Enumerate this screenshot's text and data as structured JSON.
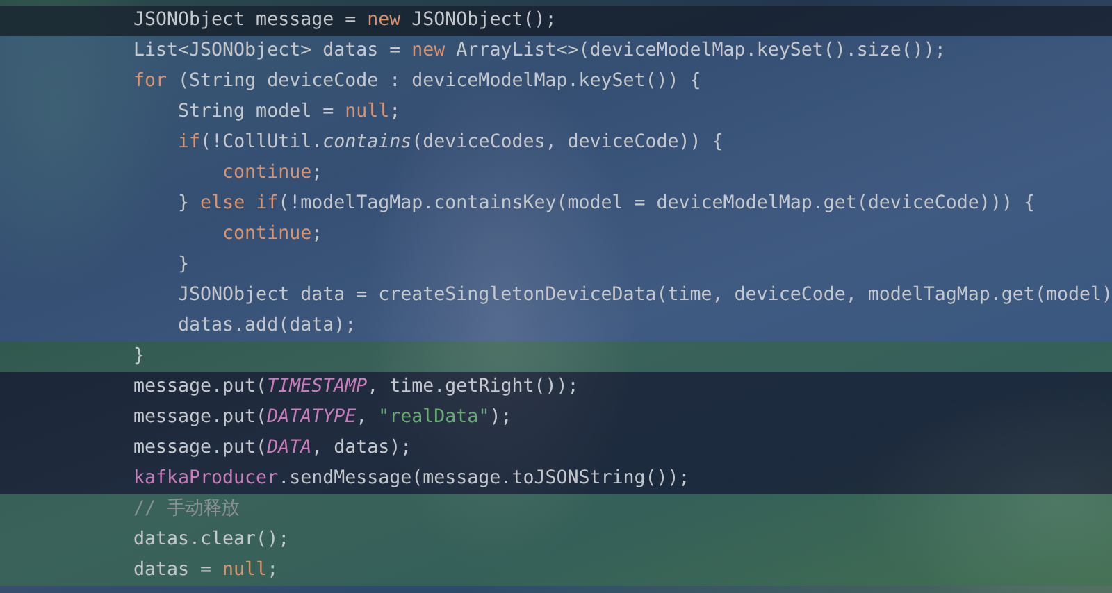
{
  "editor": {
    "lines": [
      {
        "kind": "dark",
        "tokens": [
          {
            "kind": "plain",
            "text": "JSONObject message = "
          },
          {
            "kind": "keyword",
            "text": "new"
          },
          {
            "kind": "plain",
            "text": " JSONObject();"
          }
        ]
      },
      {
        "kind": "blue",
        "tokens": [
          {
            "kind": "plain",
            "text": "List<JSONObject> datas = "
          },
          {
            "kind": "keyword",
            "text": "new"
          },
          {
            "kind": "plain",
            "text": " ArrayList<>(deviceModelMap.keySet().size());"
          }
        ]
      },
      {
        "kind": "blue",
        "tokens": [
          {
            "kind": "keyword",
            "text": "for"
          },
          {
            "kind": "plain",
            "text": " (String deviceCode : deviceModelMap.keySet()) {"
          }
        ]
      },
      {
        "kind": "blue",
        "tokens": [
          {
            "kind": "plain",
            "text": "    String model = "
          },
          {
            "kind": "keyword",
            "text": "null"
          },
          {
            "kind": "plain",
            "text": ";"
          }
        ]
      },
      {
        "kind": "blue",
        "tokens": [
          {
            "kind": "keyword",
            "text": "    if"
          },
          {
            "kind": "plain",
            "text": "(!CollUtil."
          },
          {
            "kind": "italic",
            "text": "contains"
          },
          {
            "kind": "plain",
            "text": "(deviceCodes, deviceCode)) {"
          }
        ]
      },
      {
        "kind": "blue",
        "tokens": [
          {
            "kind": "keyword",
            "text": "        continue"
          },
          {
            "kind": "plain",
            "text": ";"
          }
        ]
      },
      {
        "kind": "blue",
        "tokens": [
          {
            "kind": "plain",
            "text": "    } "
          },
          {
            "kind": "keyword",
            "text": "else if"
          },
          {
            "kind": "plain",
            "text": "(!modelTagMap.containsKey(model = deviceModelMap.get(deviceCode))) {"
          }
        ]
      },
      {
        "kind": "blue",
        "tokens": [
          {
            "kind": "keyword",
            "text": "        continue"
          },
          {
            "kind": "plain",
            "text": ";"
          }
        ]
      },
      {
        "kind": "blue",
        "tokens": [
          {
            "kind": "plain",
            "text": "    }"
          }
        ]
      },
      {
        "kind": "blue",
        "tokens": [
          {
            "kind": "plain",
            "text": "    JSONObject data = createSingletonDeviceData(time, deviceCode, modelTagMap.get(model)"
          }
        ]
      },
      {
        "kind": "blue",
        "tokens": [
          {
            "kind": "plain",
            "text": "    datas.add(data);"
          }
        ]
      },
      {
        "kind": "green",
        "tokens": [
          {
            "kind": "plain",
            "text": "}"
          }
        ]
      },
      {
        "kind": "dark",
        "tokens": [
          {
            "kind": "plain",
            "text": "message.put("
          },
          {
            "kind": "constant",
            "text": "TIMESTAMP"
          },
          {
            "kind": "plain",
            "text": ", time.getRight());"
          }
        ]
      },
      {
        "kind": "dark",
        "tokens": [
          {
            "kind": "plain",
            "text": "message.put("
          },
          {
            "kind": "constant",
            "text": "DATATYPE"
          },
          {
            "kind": "plain",
            "text": ", "
          },
          {
            "kind": "string",
            "text": "\"realData\""
          },
          {
            "kind": "plain",
            "text": ");"
          }
        ]
      },
      {
        "kind": "dark",
        "tokens": [
          {
            "kind": "plain",
            "text": "message.put("
          },
          {
            "kind": "constant",
            "text": "DATA"
          },
          {
            "kind": "plain",
            "text": ", datas);"
          }
        ]
      },
      {
        "kind": "dark",
        "tokens": [
          {
            "kind": "field",
            "text": "kafkaProducer"
          },
          {
            "kind": "plain",
            "text": ".sendMessage(message.toJSONString());"
          }
        ]
      },
      {
        "kind": "green",
        "tokens": [
          {
            "kind": "comment",
            "text": "// 手动释放"
          }
        ]
      },
      {
        "kind": "green",
        "tokens": [
          {
            "kind": "plain",
            "text": "datas.clear();"
          }
        ]
      },
      {
        "kind": "green",
        "tokens": [
          {
            "kind": "plain",
            "text": "datas = "
          },
          {
            "kind": "keyword",
            "text": "null"
          },
          {
            "kind": "plain",
            "text": ";"
          }
        ]
      }
    ]
  }
}
